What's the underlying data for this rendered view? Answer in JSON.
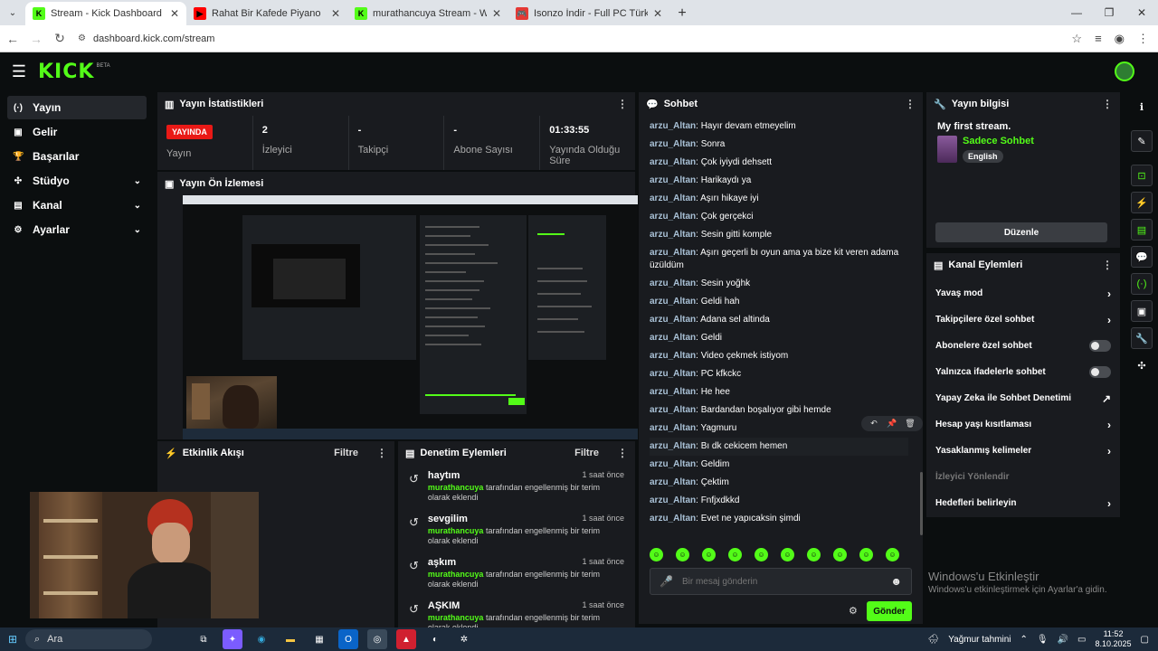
{
  "browser": {
    "tabs": [
      {
        "title": "Stream - Kick Dashboard",
        "active": true,
        "favicon": "kick-icon",
        "fav_color": "#53fc18",
        "fav_letter": "K"
      },
      {
        "title": "Rahat Bir Kafede Piyano",
        "active": false,
        "favicon": "youtube-icon",
        "fav_color": "#ff0000",
        "fav_letter": "▶"
      },
      {
        "title": "murathancuya Stream - Watch",
        "active": false,
        "favicon": "kick-icon",
        "fav_color": "#53fc18",
        "fav_letter": "K"
      },
      {
        "title": "Isonzo İndir - Full PC Türkçe + D",
        "active": false,
        "favicon": "gamepad-icon",
        "fav_color": "#e53935",
        "fav_letter": "🎮"
      }
    ],
    "url": "dashboard.kick.com/stream"
  },
  "header": {
    "logo": "KICK",
    "beta": "BETA"
  },
  "sidebar": {
    "items": [
      {
        "label": "Yayın",
        "icon": "broadcast-icon",
        "glyph": "(·)",
        "active": true,
        "chevron": false
      },
      {
        "label": "Gelir",
        "icon": "money-icon",
        "glyph": "▣",
        "active": false,
        "chevron": false
      },
      {
        "label": "Başarılar",
        "icon": "trophy-icon",
        "glyph": "🏆",
        "active": false,
        "chevron": false
      },
      {
        "label": "Stüdyo",
        "icon": "studio-icon",
        "glyph": "✣",
        "active": false,
        "chevron": true
      },
      {
        "label": "Kanal",
        "icon": "channel-icon",
        "glyph": "▤",
        "active": false,
        "chevron": true
      },
      {
        "label": "Ayarlar",
        "icon": "gear-icon",
        "glyph": "⚙",
        "active": false,
        "chevron": true
      }
    ]
  },
  "stats": {
    "title": "Yayın İstatistikleri",
    "items": [
      {
        "value": "YAYINDA",
        "label": "Yayın"
      },
      {
        "value": "2",
        "label": "İzleyici"
      },
      {
        "value": "-",
        "label": "Takipçi"
      },
      {
        "value": "-",
        "label": "Abone Sayısı"
      },
      {
        "value": "01:33:55",
        "label": "Yayında Olduğu Süre"
      }
    ]
  },
  "preview": {
    "title": "Yayın Ön İzlemesi"
  },
  "activity": {
    "title": "Etkinlik Akışı",
    "filter": "Filtre"
  },
  "moderation": {
    "title": "Denetim Eylemleri",
    "filter": "Filtre",
    "items": [
      {
        "name": "haytım",
        "time": "1 saat önce",
        "by": "murathancuya",
        "desc": "tarafından engellenmiş bir terim olarak eklendi"
      },
      {
        "name": "sevgilim",
        "time": "1 saat önce",
        "by": "murathancuya",
        "desc": "tarafından engellenmiş bir terim olarak eklendi"
      },
      {
        "name": "aşkım",
        "time": "1 saat önce",
        "by": "murathancuya",
        "desc": "tarafından engellenmiş bir terim olarak eklendi"
      },
      {
        "name": "AŞKIM",
        "time": "1 saat önce",
        "by": "murathancuya",
        "desc": "tarafından engellenmiş bir terim olarak eklendi"
      }
    ]
  },
  "chat": {
    "title": "Sohbet",
    "messages": [
      {
        "user": "arzu_Altan",
        "text": "Hayır devam etmeyelim"
      },
      {
        "user": "arzu_Altan",
        "text": "Sonra"
      },
      {
        "user": "arzu_Altan",
        "text": "Çok iyiydi dehsett"
      },
      {
        "user": "arzu_Altan",
        "text": "Harikaydı ya"
      },
      {
        "user": "arzu_Altan",
        "text": "Aşırı hikaye iyi"
      },
      {
        "user": "arzu_Altan",
        "text": "Çok gerçekci"
      },
      {
        "user": "arzu_Altan",
        "text": "Sesin gitti komple"
      },
      {
        "user": "arzu_Altan",
        "text": "Aşırı geçerli bı oyun ama ya bize kit veren adama üzüldüm"
      },
      {
        "user": "arzu_Altan",
        "text": "Sesin yoğhk"
      },
      {
        "user": "arzu_Altan",
        "text": "Geldi hah"
      },
      {
        "user": "arzu_Altan",
        "text": "Adana sel altinda"
      },
      {
        "user": "arzu_Altan",
        "text": "Geldi"
      },
      {
        "user": "arzu_Altan",
        "text": "Video çekmek istiyom"
      },
      {
        "user": "arzu_Altan",
        "text": "PC kfkckc"
      },
      {
        "user": "arzu_Altan",
        "text": "He hee"
      },
      {
        "user": "arzu_Altan",
        "text": "Bardandan boşalıyor gibi hemde"
      },
      {
        "user": "arzu_Altan",
        "text": "Yagmuru"
      },
      {
        "user": "arzu_Altan",
        "text": "Bı dk cekicem hemen"
      },
      {
        "user": "arzu_Altan",
        "text": "Geldim"
      },
      {
        "user": "arzu_Altan",
        "text": "Çektim"
      },
      {
        "user": "arzu_Altan",
        "text": "Fnfjxdkkd"
      },
      {
        "user": "arzu_Altan",
        "text": "Evet ne yapıcaksin şimdi"
      }
    ],
    "placeholder": "Bir mesaj gönderin",
    "send": "Gönder"
  },
  "stream_info": {
    "title": "Yayın bilgisi",
    "stream_title": "My first stream.",
    "category": "Sadece Sohbet",
    "language": "English",
    "edit": "Düzenle"
  },
  "channel_actions": {
    "title": "Kanal Eylemleri",
    "items": [
      {
        "label": "Yavaş mod",
        "kind": "arrow",
        "glyph": "›"
      },
      {
        "label": "Takipçilere özel sohbet",
        "kind": "arrow",
        "glyph": "›"
      },
      {
        "label": "Abonelere özel sohbet",
        "kind": "toggle",
        "glyph": ""
      },
      {
        "label": "Yalnızca ifadelerle sohbet",
        "kind": "toggle",
        "glyph": ""
      },
      {
        "label": "Yapay Zeka ile Sohbet Denetimi",
        "kind": "external",
        "glyph": "↗"
      },
      {
        "label": "Hesap yaşı kısıtlaması",
        "kind": "arrow",
        "glyph": "›"
      },
      {
        "label": "Yasaklanmış kelimeler",
        "kind": "arrow",
        "glyph": "›"
      },
      {
        "label": "İzleyici Yönlendir",
        "kind": "muted",
        "glyph": ""
      },
      {
        "label": "Hedefleri belirleyin",
        "kind": "arrow",
        "glyph": "›"
      }
    ]
  },
  "windows_notice": {
    "title": "Windows'u Etkinleştir",
    "subtitle": "Windows'u etkinleştirmek için Ayarlar'a gidin."
  },
  "taskbar": {
    "search": "Ara",
    "weather": "Yağmur tahmini",
    "time": "11:52",
    "date": "8.10.2025"
  },
  "colors": {
    "accent": "#53fc18",
    "live": "#e91916",
    "username": "#a9c1d6"
  }
}
